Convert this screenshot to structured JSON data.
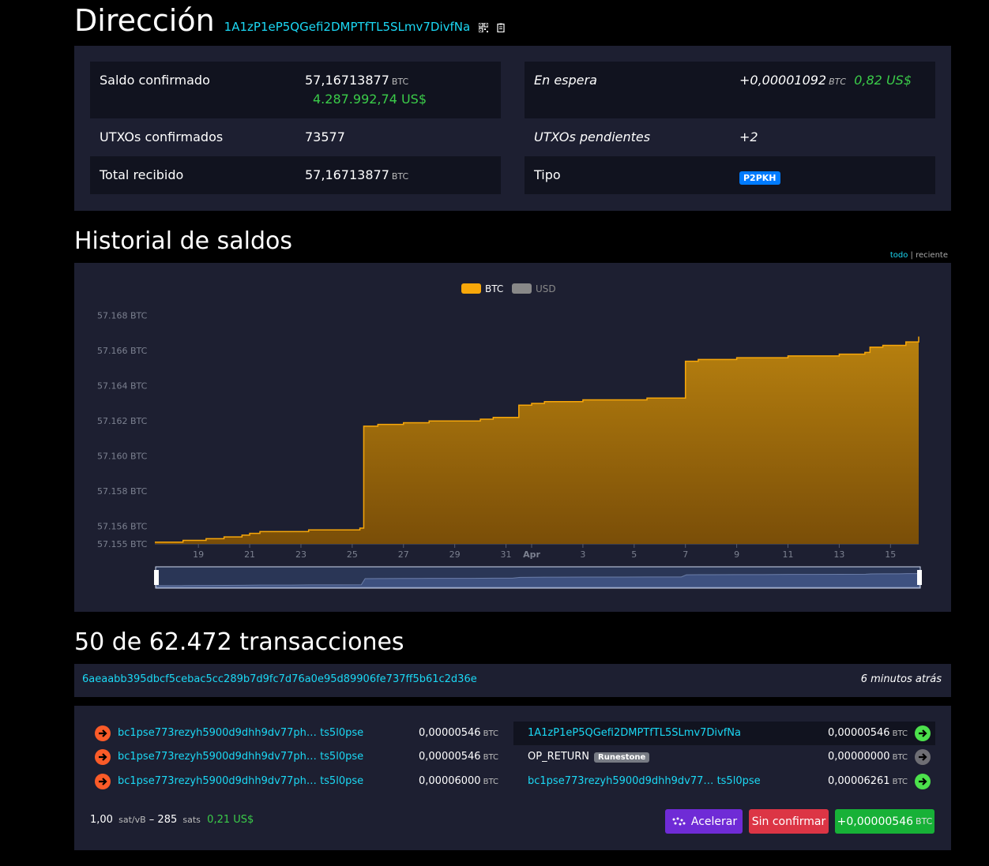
{
  "header": {
    "title": "Dirección",
    "address": "1A1zP1eP5QGefi2DMPTfTL5SLmv7DivfNa",
    "icons": [
      "qr-code-icon",
      "copy-icon"
    ]
  },
  "summary": {
    "confirmed_balance_label": "Saldo confirmado",
    "confirmed_balance_btc": "57,16713877",
    "confirmed_balance_usd": "4.287.992,74 US$",
    "pending_label": "En espera",
    "pending_btc": "+0,00001092",
    "pending_usd": "0,82 US$",
    "utxos_confirmed_label": "UTXOs confirmados",
    "utxos_confirmed": "73577",
    "utxos_pending_label": "UTXOs pendientes",
    "utxos_pending": "+2",
    "total_received_label": "Total recibido",
    "total_received_btc": "57,16713877",
    "type_label": "Tipo",
    "type_value": "P2PKH",
    "unit": "BTC"
  },
  "history": {
    "title": "Historial de saldos",
    "range_all": "todo",
    "range_recent": "reciente"
  },
  "chart_data": {
    "type": "area",
    "legend": [
      "BTC",
      "USD"
    ],
    "y_tick_labels": [
      "57.168 BTC",
      "57.166 BTC",
      "57.164 BTC",
      "57.162 BTC",
      "57.160 BTC",
      "57.158 BTC",
      "57.156 BTC",
      "57.155 BTC"
    ],
    "y_ticks": [
      57.168,
      57.166,
      57.164,
      57.162,
      57.16,
      57.158,
      57.156,
      57.155
    ],
    "ylim": [
      57.155,
      57.1692
    ],
    "x_tick_labels": [
      "19",
      "21",
      "23",
      "25",
      "27",
      "29",
      "31",
      "Apr",
      "3",
      "5",
      "7",
      "9",
      "11",
      "13",
      "15"
    ],
    "x_ticks": [
      19,
      21,
      23,
      25,
      27,
      29,
      31,
      32,
      34,
      36,
      38,
      40,
      42,
      44,
      46
    ],
    "xlim": [
      17.3,
      47.1
    ],
    "x_note": "day number, March 1 = 1; April dates continue as 31+day",
    "color": "#f7a70a",
    "series": [
      {
        "name": "BTC",
        "x": [
          17.3,
          18.3,
          18.4,
          19.3,
          20.0,
          20.7,
          21.0,
          21.4,
          22.6,
          23.3,
          24.0,
          24.5,
          25.3,
          25.45,
          26.0,
          26.2,
          27.0,
          27.5,
          28.0,
          28.8,
          29.6,
          30.0,
          30.5,
          31.2,
          31.5,
          32.0,
          32.5,
          33.0,
          34.0,
          35.5,
          36.5,
          37.5,
          37.8,
          38.0,
          38.5,
          39.0,
          40.0,
          41.0,
          42.0,
          43.0,
          44.0,
          45.0,
          45.2,
          45.7,
          46.3,
          46.6,
          47.0,
          47.1
        ],
        "y": [
          57.1551,
          57.1551,
          57.1552,
          57.1553,
          57.1554,
          57.1555,
          57.1556,
          57.1557,
          57.1557,
          57.1558,
          57.1558,
          57.1558,
          57.1559,
          57.1617,
          57.1618,
          57.1618,
          57.1619,
          57.1619,
          57.162,
          57.162,
          57.162,
          57.1621,
          57.1622,
          57.1622,
          57.1629,
          57.163,
          57.1631,
          57.1631,
          57.1632,
          57.1632,
          57.1633,
          57.1633,
          57.1633,
          57.1654,
          57.1655,
          57.1655,
          57.1656,
          57.1656,
          57.1657,
          57.1657,
          57.1658,
          57.1659,
          57.1662,
          57.1663,
          57.1663,
          57.1665,
          57.1665,
          57.1668
        ]
      }
    ]
  },
  "transactions": {
    "title": "50 de 62.472 transacciones",
    "txid": "6aeaabb395dbcf5cebac5cc289b7d9fc7d76a0e95d89906fe737ff5b61c2d36e",
    "time": "6 minutos atrás",
    "inputs": [
      {
        "addr_start": "bc1pse773rezyh5900d9dhh9dv77ph…",
        "addr_end": "ts5l0pse",
        "amount": "0,00000546",
        "unit": "BTC"
      },
      {
        "addr_start": "bc1pse773rezyh5900d9dhh9dv77ph…",
        "addr_end": "ts5l0pse",
        "amount": "0,00000546",
        "unit": "BTC"
      },
      {
        "addr_start": "bc1pse773rezyh5900d9dhh9dv77ph…",
        "addr_end": "ts5l0pse",
        "amount": "0,00006000",
        "unit": "BTC"
      }
    ],
    "outputs": [
      {
        "addr": "1A1zP1eP5QGefi2DMPTfTL5SLmv7DivfNa",
        "amount": "0,00000546",
        "unit": "BTC"
      },
      {
        "addr": "OP_RETURN",
        "badge": "Runestone",
        "amount": "0,00000000",
        "unit": "BTC"
      },
      {
        "addr_start": "bc1pse773rezyh5900d9dhh9dv77…",
        "addr_end": "ts5l0pse",
        "amount": "0,00006261",
        "unit": "BTC"
      }
    ],
    "fee_rate": "1,00",
    "fee_rate_unit": "sat/vB",
    "fee_sep": "–",
    "fee_sats": "285",
    "fee_sats_unit": "sats",
    "fee_usd": "0,21 US$",
    "accelerate_label": "Acelerar",
    "unconfirmed_label": "Sin confirmar",
    "net_amount": "+0,00000546",
    "net_unit": "BTC"
  },
  "colors": {
    "bg": "#000000",
    "panel": "#1d1f31",
    "link": "#1bd8f4",
    "green": "#1cff1c",
    "chart": "#f7a70a"
  }
}
